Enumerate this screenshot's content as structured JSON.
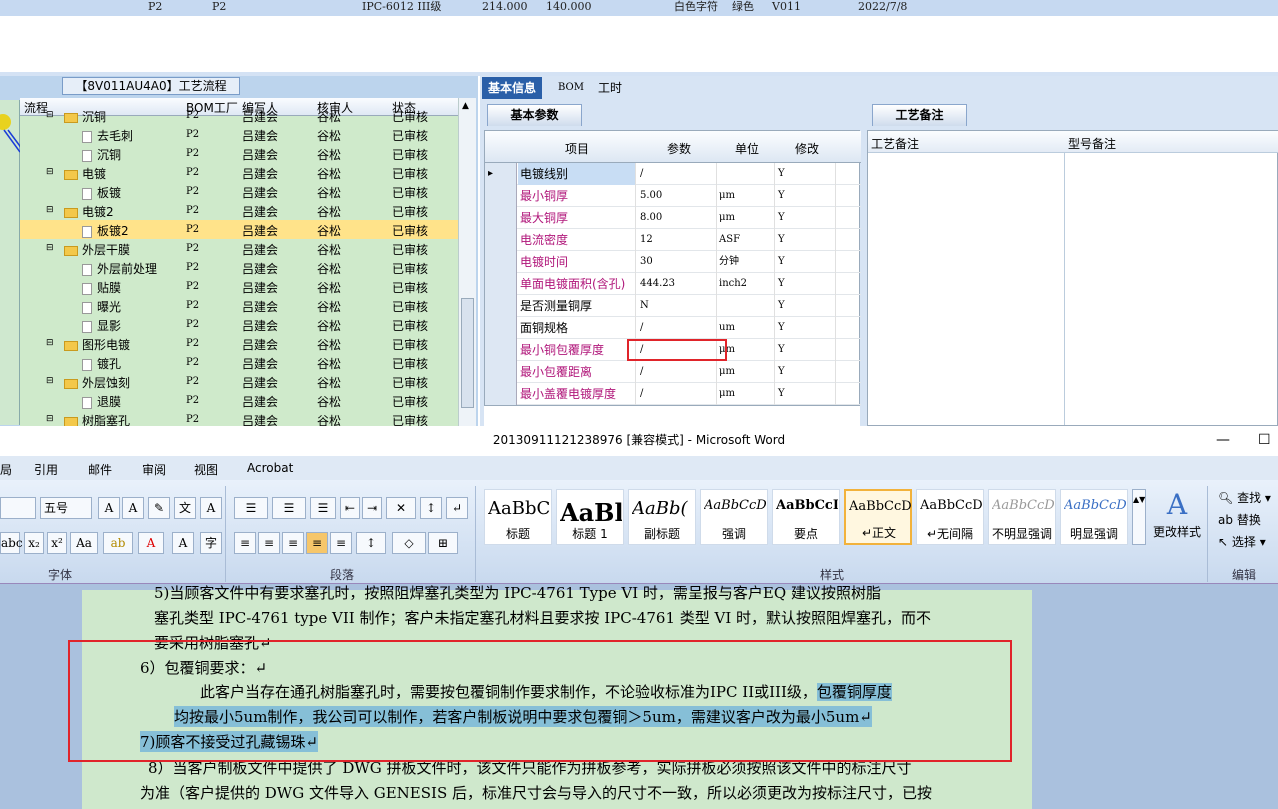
{
  "top_row": {
    "c1": "P2",
    "c2": "P2",
    "c3": "IPC-6012 III级",
    "c4": "214.000",
    "c5": "140.000",
    "c6": "白色字符",
    "c7": "绿色",
    "c8": "V011",
    "c9": "2022/7/8"
  },
  "tree": {
    "title": "【8V011AU4A0】工艺流程",
    "headers": [
      "流程",
      "BOM工厂",
      "编写人",
      "核审人",
      "状态"
    ],
    "rows": [
      {
        "label": "沉铜",
        "kind": "folder",
        "indent": 1,
        "c2": "P2",
        "c3": "吕建会",
        "c4": "谷松",
        "c5": "已审核",
        "partial": true
      },
      {
        "label": "去毛刺",
        "kind": "doc",
        "indent": 2,
        "c2": "P2",
        "c3": "吕建会",
        "c4": "谷松",
        "c5": "已审核"
      },
      {
        "label": "沉铜",
        "kind": "doc",
        "indent": 2,
        "c2": "P2",
        "c3": "吕建会",
        "c4": "谷松",
        "c5": "已审核"
      },
      {
        "label": "电镀",
        "kind": "folder",
        "indent": 1,
        "c2": "P2",
        "c3": "吕建会",
        "c4": "谷松",
        "c5": "已审核"
      },
      {
        "label": "板镀",
        "kind": "doc",
        "indent": 2,
        "c2": "P2",
        "c3": "吕建会",
        "c4": "谷松",
        "c5": "已审核"
      },
      {
        "label": "电镀2",
        "kind": "folder",
        "indent": 1,
        "c2": "P2",
        "c3": "吕建会",
        "c4": "谷松",
        "c5": "已审核"
      },
      {
        "label": "板镀2",
        "kind": "doc",
        "indent": 2,
        "c2": "P2",
        "c3": "吕建会",
        "c4": "谷松",
        "c5": "已审核",
        "selected": true
      },
      {
        "label": "外层干膜",
        "kind": "folder",
        "indent": 1,
        "c2": "P2",
        "c3": "吕建会",
        "c4": "谷松",
        "c5": "已审核"
      },
      {
        "label": "外层前处理",
        "kind": "doc",
        "indent": 2,
        "c2": "P2",
        "c3": "吕建会",
        "c4": "谷松",
        "c5": "已审核"
      },
      {
        "label": "贴膜",
        "kind": "doc",
        "indent": 2,
        "c2": "P2",
        "c3": "吕建会",
        "c4": "谷松",
        "c5": "已审核"
      },
      {
        "label": "曝光",
        "kind": "doc",
        "indent": 2,
        "c2": "P2",
        "c3": "吕建会",
        "c4": "谷松",
        "c5": "已审核"
      },
      {
        "label": "显影",
        "kind": "doc",
        "indent": 2,
        "c2": "P2",
        "c3": "吕建会",
        "c4": "谷松",
        "c5": "已审核"
      },
      {
        "label": "图形电镀",
        "kind": "folder",
        "indent": 1,
        "c2": "P2",
        "c3": "吕建会",
        "c4": "谷松",
        "c5": "已审核"
      },
      {
        "label": "镀孔",
        "kind": "doc",
        "indent": 2,
        "c2": "P2",
        "c3": "吕建会",
        "c4": "谷松",
        "c5": "已审核"
      },
      {
        "label": "外层蚀刻",
        "kind": "folder",
        "indent": 1,
        "c2": "P2",
        "c3": "吕建会",
        "c4": "谷松",
        "c5": "已审核"
      },
      {
        "label": "退膜",
        "kind": "doc",
        "indent": 2,
        "c2": "P2",
        "c3": "吕建会",
        "c4": "谷松",
        "c5": "已审核"
      },
      {
        "label": "树脂塞孔",
        "kind": "folder",
        "indent": 1,
        "c2": "P2",
        "c3": "吕建会",
        "c4": "谷松",
        "c5": "已审核"
      }
    ]
  },
  "right_tabs": [
    "基本信息",
    "BOM",
    "工时"
  ],
  "basic_params": {
    "tab": "基本参数",
    "headers": [
      "项目",
      "参数",
      "单位",
      "修改"
    ],
    "rows": [
      {
        "name": "电镀线别",
        "value": "/",
        "unit": "",
        "mod": "Y",
        "pink": false,
        "current": true
      },
      {
        "name": "最小铜厚",
        "value": "5.00",
        "unit": "μm",
        "mod": "Y",
        "pink": true
      },
      {
        "name": "最大铜厚",
        "value": "8.00",
        "unit": "μm",
        "mod": "Y",
        "pink": true
      },
      {
        "name": "电流密度",
        "value": "12",
        "unit": "ASF",
        "mod": "Y",
        "pink": true
      },
      {
        "name": "电镀时间",
        "value": "30",
        "unit": "分钟",
        "mod": "Y",
        "pink": true
      },
      {
        "name": "单面电镀面积(含孔)",
        "value": "444.23",
        "unit": "inch2",
        "mod": "Y",
        "pink": true
      },
      {
        "name": "是否测量铜厚",
        "value": "N",
        "unit": "",
        "mod": "Y",
        "pink": false
      },
      {
        "name": "面铜规格",
        "value": "/",
        "unit": "um",
        "mod": "Y",
        "pink": false
      },
      {
        "name": "最小铜包覆厚度",
        "value": "/",
        "unit": "μm",
        "mod": "Y",
        "pink": true
      },
      {
        "name": "最小包覆距离",
        "value": "/",
        "unit": "μm",
        "mod": "Y",
        "pink": true
      },
      {
        "name": "最小盖覆电镀厚度",
        "value": "/",
        "unit": "μm",
        "mod": "Y",
        "pink": true
      }
    ]
  },
  "process_notes": {
    "tab": "工艺备注",
    "col1": "工艺备注",
    "col2": "型号备注"
  },
  "word": {
    "title": "20130911121238976 [兼容模式] - Microsoft Word",
    "minimize": "—",
    "maximize": "☐",
    "ribbon_tabs": [
      "局",
      "引用",
      "邮件",
      "审阅",
      "视图",
      "Acrobat"
    ],
    "font_size": "五号",
    "group_font": "字体",
    "group_para": "段落",
    "group_styles": "样式",
    "group_edit": "编辑",
    "styles": [
      {
        "preview": "AaBbC",
        "label": "标题"
      },
      {
        "preview": "AaBl",
        "label": "标题 1"
      },
      {
        "preview": "AaBb(",
        "label": "副标题"
      },
      {
        "preview": "AaBbCcDc",
        "label": "强调"
      },
      {
        "preview": "AaBbCcD",
        "label": "要点"
      },
      {
        "preview": "AaBbCcDc",
        "label": "↵正文",
        "selected": true
      },
      {
        "preview": "AaBbCcDc",
        "label": "↵无间隔"
      },
      {
        "preview": "AaBbCcDc",
        "label": "不明显强调"
      },
      {
        "preview": "AaBbCcDc",
        "label": "明显强调"
      }
    ],
    "change_styles": "更改样式",
    "find": "查找",
    "replace": "替换",
    "select": "选择",
    "doc_lines": {
      "l0": "5)当顾客文件中有要求塞孔时，按照阻焊塞孔类型为 IPC-4761 Type VI 时，需呈报与客户EQ 建议按照树脂",
      "l1": "塞孔类型 IPC-4761 type VII 制作；客户未指定塞孔材料且要求按 IPC-4761 类型 VI 时，默认按照阻焊塞孔，而不",
      "l2": "要采用树脂塞孔↵",
      "l3": "6）包覆铜要求：↵",
      "l4a": "此客户当存在通孔树脂塞孔时，需要按包覆铜制作要求制作，不论验收标准为IPC II或III级，",
      "l4b": "包覆铜厚度",
      "l5": "均按最小5um制作，我公司可以制作，若客户制板说明中要求包覆铜＞5um，需建议客户改为最小5um↵",
      "l6": "7)顾客不接受过孔藏锡珠↵",
      "l7": "8）当客户制板文件中提供了 DWG 拼板文件时，该文件只能作为拼板参考，实际拼板必须按照该文件中的标注尺寸",
      "l8": "为准（客户提供的 DWG 文件导入 GENESIS 后，标准尺寸会与导入的尺寸不一致，所以必须更改为按标注尺寸，已按"
    }
  }
}
